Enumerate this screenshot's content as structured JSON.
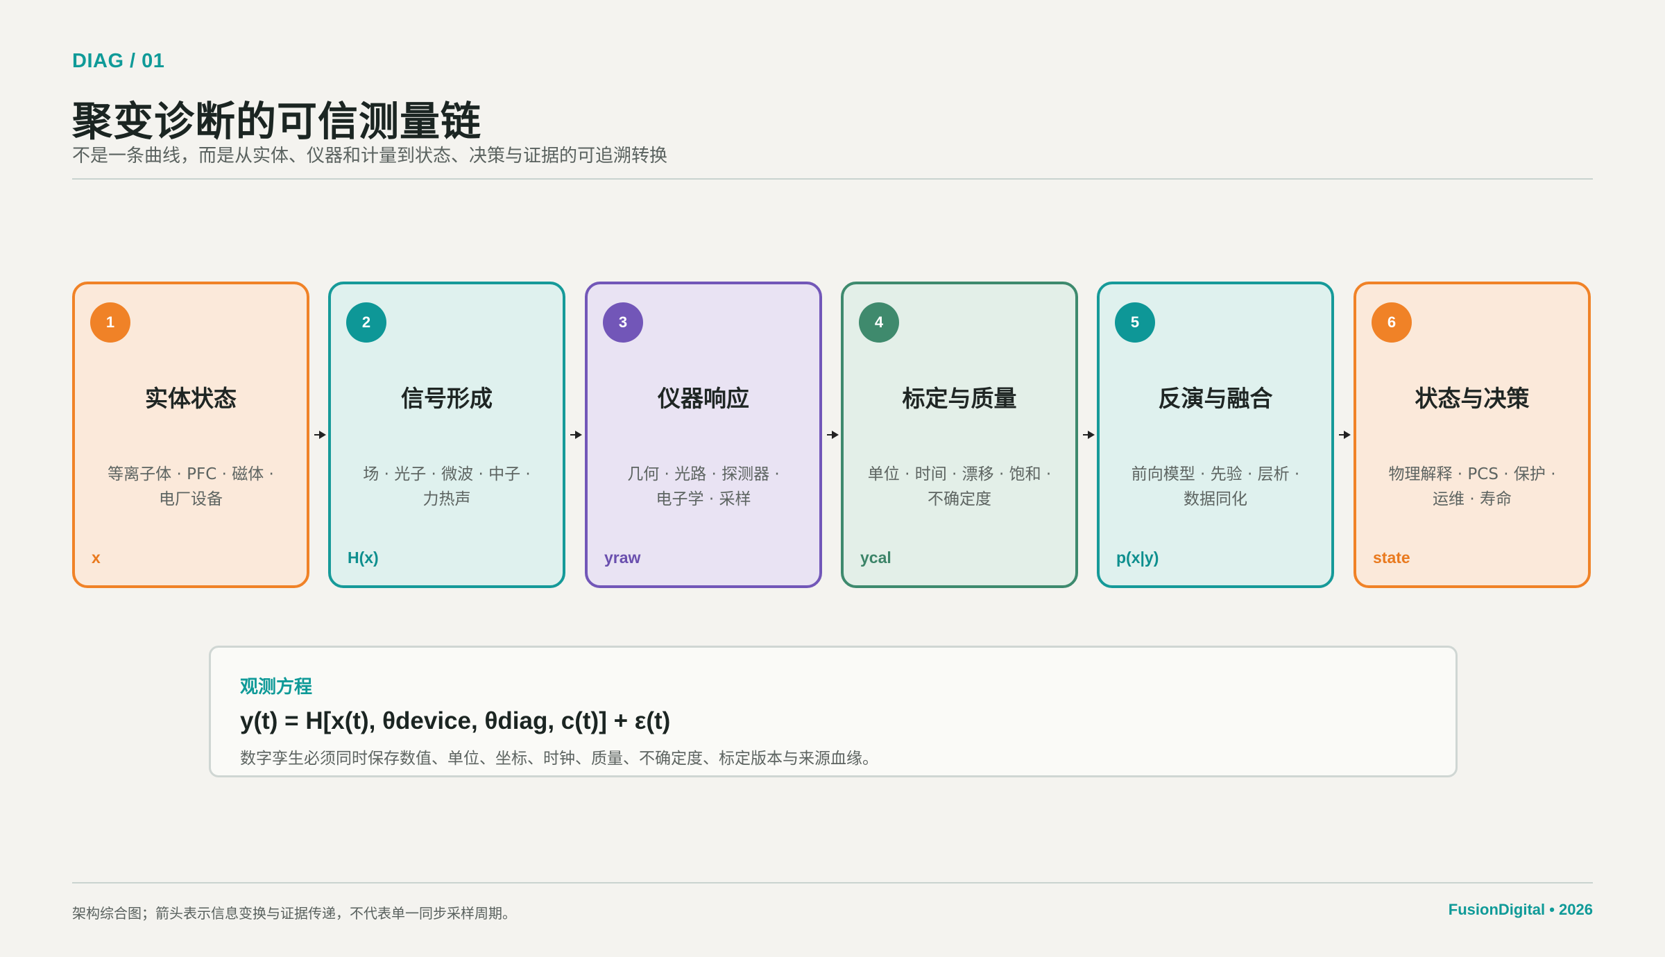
{
  "header": {
    "kicker": "DIAG / 01",
    "title": "聚变诊断的可信测量链",
    "subtitle": "不是一条曲线，而是从实体、仪器和计量到状态、决策与证据的可追溯转换"
  },
  "stages": [
    {
      "num": "1",
      "title": "实体状态",
      "desc_line1": "等离子体 · PFC · 磁体 ·",
      "desc_line2": "电厂设备",
      "var": "x",
      "colors": {
        "border": "#f08227",
        "fill": "#fbe9da",
        "badge": "#f08227",
        "var": "#e97a1f"
      }
    },
    {
      "num": "2",
      "title": "信号形成",
      "desc_line1": "场 · 光子 · 微波 · 中子 ·",
      "desc_line2": "力热声",
      "var": "H(x)",
      "colors": {
        "border": "#169a99",
        "fill": "#dff1ee",
        "badge": "#0e9797",
        "var": "#0e8f8e"
      }
    },
    {
      "num": "3",
      "title": "仪器响应",
      "desc_line1": "几何 · 光路 · 探测器 ·",
      "desc_line2": "电子学 · 采样",
      "var": "yraw",
      "colors": {
        "border": "#7257b8",
        "fill": "#e9e3f3",
        "badge": "#7256b8",
        "var": "#6a4fae"
      }
    },
    {
      "num": "4",
      "title": "标定与质量",
      "desc_line1": "单位 · 时间 · 漂移 · 饱和 ·",
      "desc_line2": "不确定度",
      "var": "ycal",
      "colors": {
        "border": "#3e8a6e",
        "fill": "#e3efe8",
        "badge": "#3f8a6d",
        "var": "#3c8468"
      }
    },
    {
      "num": "5",
      "title": "反演与融合",
      "desc_line1": "前向模型 · 先验 · 层析 ·",
      "desc_line2": "数据同化",
      "var": "p(x|y)",
      "colors": {
        "border": "#169a99",
        "fill": "#dff1ee",
        "badge": "#0e9797",
        "var": "#0e8f8e"
      }
    },
    {
      "num": "6",
      "title": "状态与决策",
      "desc_line1": "物理解释 · PCS · 保护 ·",
      "desc_line2": "运维 · 寿命",
      "var": "state",
      "colors": {
        "border": "#f08227",
        "fill": "#fbe9da",
        "badge": "#f08227",
        "var": "#e97a1f"
      }
    }
  ],
  "equation": {
    "label": "观测方程",
    "formula": "y(t) = H[x(t), θdevice, θdiag, c(t)] + ε(t)",
    "note": "数字孪生必须同时保存数值、单位、坐标、时钟、质量、不确定度、标定版本与来源血缘。"
  },
  "footer": {
    "note": "架构综合图；箭头表示信息变换与证据传递，不代表单一同步采样周期。",
    "brand": "FusionDigital • 2026"
  }
}
